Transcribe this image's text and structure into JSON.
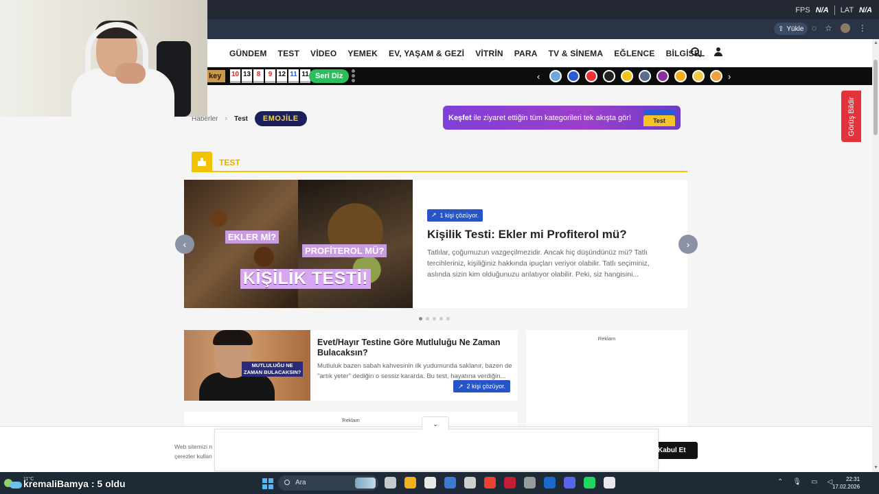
{
  "overlay": {
    "fps_label": "FPS",
    "fps_value": "N/A",
    "lat_label": "LAT",
    "lat_value": "N/A"
  },
  "browser": {
    "upload_label": "Yükle"
  },
  "nav": {
    "items": [
      "GÜNDEM",
      "TEST",
      "VİDEO",
      "YEMEK",
      "EV, YAŞAM & GEZİ",
      "VİTRİN",
      "PARA",
      "TV & SİNEMA",
      "EĞLENCE",
      "BİLGİSEL"
    ]
  },
  "promo": {
    "key_label": "key",
    "days": [
      "10",
      "13",
      "8",
      "9",
      "12",
      "11",
      "11"
    ],
    "day_colors": [
      "#d22",
      "#111",
      "#d22",
      "#d22",
      "#111",
      "#2a5bd7",
      "#111"
    ],
    "seri_button": "Seri Diz",
    "brand_colors": [
      "#6fa8d6",
      "#2a5bd7",
      "#e33",
      "#222",
      "#f0c419",
      "#5a6d8f",
      "#8a2f9c",
      "#f2b01e",
      "#f2c94c",
      "#f0a13a"
    ]
  },
  "breadcrumb": {
    "home": "Haberler",
    "current": "Test",
    "emojile": "EMOJİLE"
  },
  "kesfet": {
    "bold": "Keşfet",
    "rest": " ile ziyaret ettiğin tüm kategorileri tek akışta gör!",
    "chip": "Test"
  },
  "feedback": "Görüş Bildir",
  "section": {
    "title": "TEST"
  },
  "featured": {
    "solver": "1 kişi çözüyor.",
    "title": "Kişilik Testi: Ekler mi Profiterol mü?",
    "description": "Tatlılar, çoğumuzun vazgeçilmezidir. Ancak hiç düşündünüz mü? Tatlı tercihleriniz, kişiliğiniz hakkında ipuçları veriyor olabilir. Tatlı seçiminiz, aslında sizin kim olduğunuzu anlatıyor olabilir. Peki, siz hangisini...",
    "image_text_1": "EKLER Mİ?",
    "image_text_2": "PROFİTEROL MÜ?",
    "image_text_3": "KİŞİLİK TESTİ!",
    "prev": "‹",
    "next": "›",
    "slide_count": 5,
    "active_slide": 1
  },
  "card": {
    "title": "Evet/Hayır Testine Göre Mutluluğu Ne Zaman Bulacaksın?",
    "description": "Mutluluk bazen sabah kahvesinin ilk yudumunda saklanır, bazen de \"artık yeter\" dediğin o sessiz kararda. Bu test, hayatına verdiğin...",
    "thumb_label_1": "MUTLULUĞU NE",
    "thumb_label_2": "ZAMAN BULACAKSIN?",
    "solver": "2 kişi çözüyor."
  },
  "ads": {
    "label_right": "Reklam",
    "label_bottom": "Reklam"
  },
  "cookie": {
    "text_line1": "Web sitemizi n",
    "text_line2": "çerezler kullan",
    "accept": "Kabul Et",
    "collapse": "⌄"
  },
  "taskbar": {
    "temp": "11°C",
    "chat": "kremaliBamya : 5 oldu",
    "search_placeholder": "Ara",
    "time": "22:31",
    "date": "17.02.2026",
    "app_colors": [
      "#c9c9c9",
      "#f2b01e",
      "#e8e8e8",
      "#3b7bd8",
      "#cfcfcf",
      "#e94235",
      "#c21f36",
      "#9a9a9a",
      "#1b6ac9",
      "#5865f2",
      "#1ed760",
      "#eaeaea"
    ]
  }
}
